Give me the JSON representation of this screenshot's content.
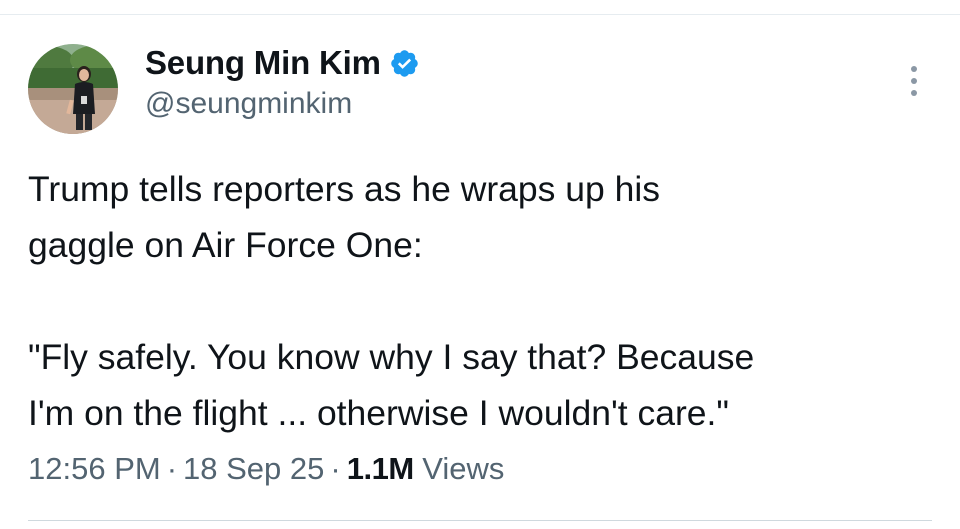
{
  "tweet": {
    "author": {
      "display_name": "Seung Min Kim",
      "handle": "@seungminkim",
      "verified_icon": "verified-badge-icon",
      "avatar_alt": "profile photo"
    },
    "more_icon": "more-options-icon",
    "text": "Trump tells reporters as he wraps up his\ngaggle on Air Force One:\n\n\"Fly safely. You know why I say that? Because\nI'm on the flight ... otherwise I wouldn't care.\"",
    "meta": {
      "time": "12:56 PM",
      "separator": "·",
      "date": "18 Sep 25",
      "views_count": "1.1M",
      "views_label": "Views"
    }
  },
  "colors": {
    "text_primary": "#0f1419",
    "text_secondary": "#536471",
    "verified_blue": "#1d9bf0",
    "divider": "#cfd9de"
  }
}
